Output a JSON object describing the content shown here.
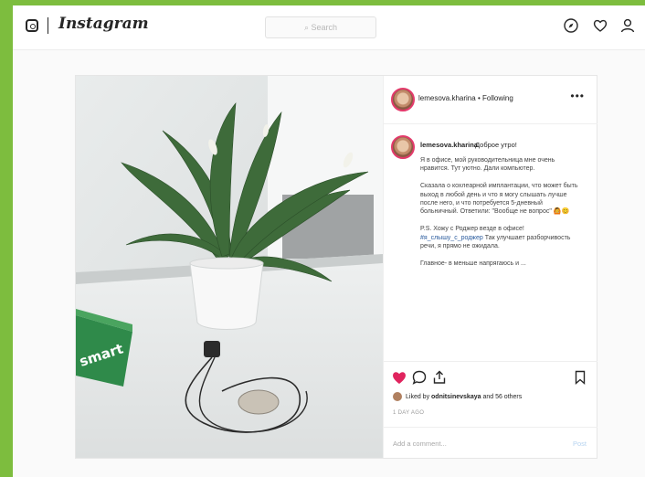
{
  "app": {
    "logo_text": "Instagram",
    "search_placeholder": "Search"
  },
  "nav": {
    "icons": [
      "compass-icon",
      "heart-icon",
      "profile-icon"
    ]
  },
  "post": {
    "header": {
      "username": "lemesova.kharina",
      "separator": "•",
      "follow_status": "Following",
      "more_label": "•••"
    },
    "caption": {
      "username": "lemesova.kharina",
      "greeting": "Доброе утро!",
      "paragraphs": [
        "Я в офисе, мой руководительница мне очень нравится. Тут уютно. Дали компьютер.",
        "Сказала о кохлеарной имплантации, что может быть выход в любой день и что я могу слышать лучше после него, и что потребуется 5-дневный больничный. Ответили: \"Вообще не вопрос\" 🙆😊",
        "P.S. Хожу с Роджер везде в офисе!",
        "Так улучшает разборчивость речи, я прямо не ожидала.",
        "Главное- в меньше напрягаюсь и ..."
      ],
      "hashtag": "#я_слышу_с_роджер"
    },
    "actions": {
      "icons": [
        "heart-filled-icon",
        "comment-icon",
        "share-icon",
        "bookmark-icon"
      ],
      "like_color": "#e0245e"
    },
    "likes": {
      "prefix": "Liked by",
      "user": "odnitsinevskaya",
      "suffix": "and 56 others"
    },
    "time_ago": "1 DAY AGO",
    "add_comment_placeholder": "Add a comment...",
    "post_button": "Post"
  }
}
